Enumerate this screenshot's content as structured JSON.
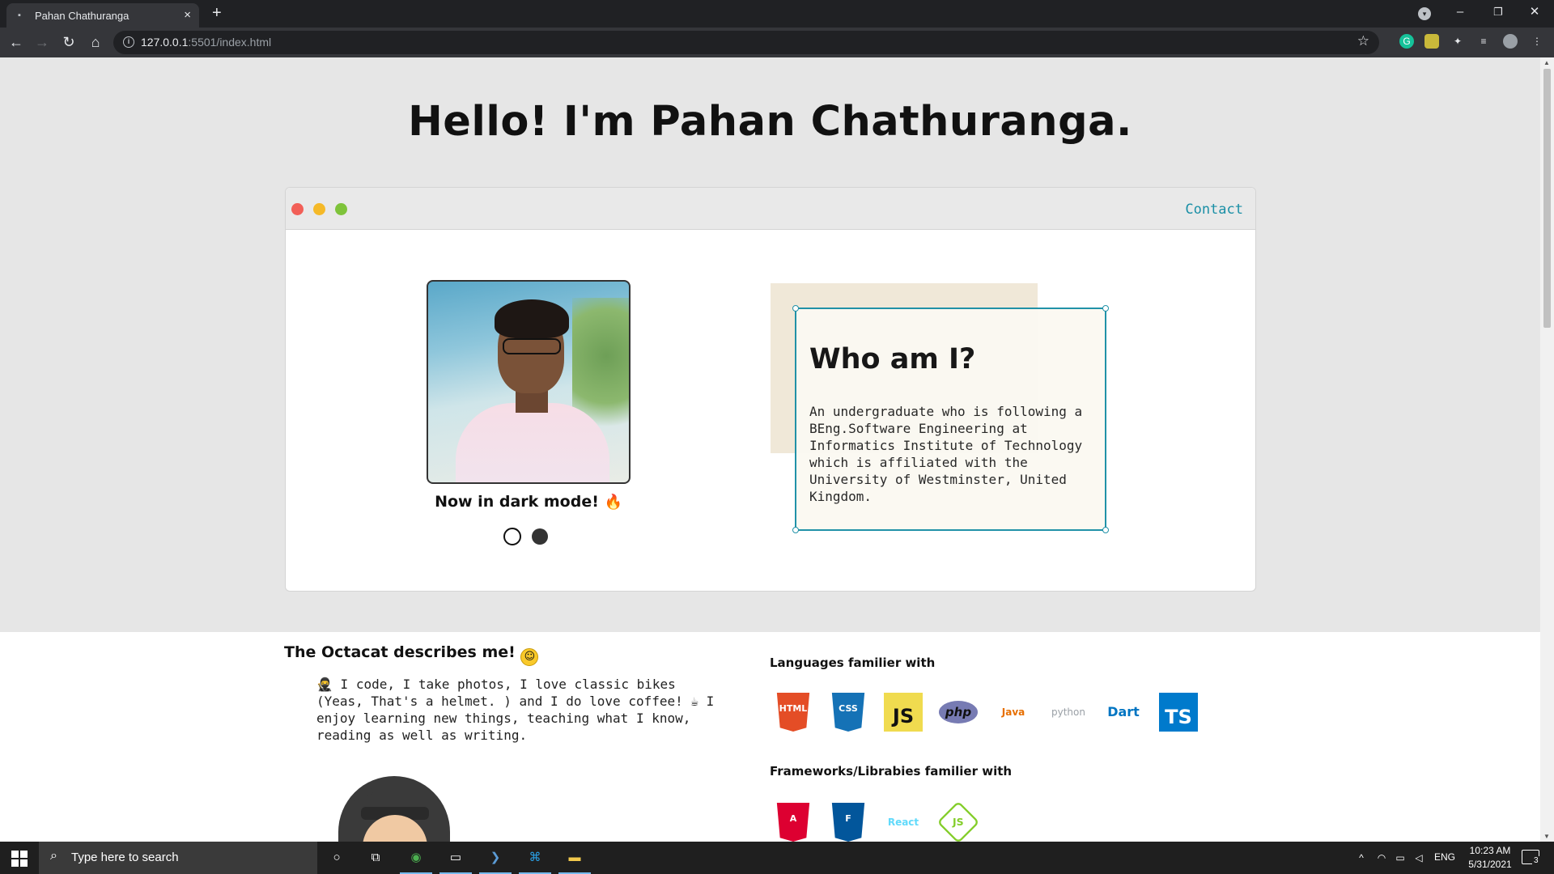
{
  "browser": {
    "tab_title": "Pahan Chathuranga",
    "tab_close": "×",
    "new_tab": "+",
    "url_host": "127.0.0.1",
    "url_rest": ":5501/index.html",
    "window_controls": [
      "–",
      "❐",
      "✕"
    ]
  },
  "page": {
    "hero_title": "Hello! I'm Pahan Chathuranga.",
    "window_bar": {
      "dot_colors": [
        "#f25f57",
        "#f5b928",
        "#7ec33a"
      ],
      "contact_label": "Contact"
    },
    "profile": {
      "dark_mode_caption": "Now in dark mode!",
      "flame_icon": "🔥",
      "toggles": [
        "light",
        "dark"
      ]
    },
    "about": {
      "title": "Who am I?",
      "text": "An undergraduate who is following a BEng.Software Engineering at Informatics Institute of Technology which is affiliated with the University of Westminster, United Kingdom."
    },
    "octacat": {
      "title": "The Octacat describes me!",
      "text": "🥷 I code, I take photos, I love classic bikes (Yeas, That's a helmet. ) and I do love coffee! ☕ I enjoy learning new things, teaching what I know, reading as well as writing."
    },
    "languages": {
      "title": "Languages familier with",
      "items": [
        {
          "name": "HTML5",
          "label": "HTML",
          "color": "#e44d26"
        },
        {
          "name": "CSS3",
          "label": "CSS",
          "color": "#1572b6"
        },
        {
          "name": "JavaScript",
          "label": "JS",
          "color": "#f0db4f"
        },
        {
          "name": "PHP",
          "label": "php",
          "color": "#777bb3"
        },
        {
          "name": "Java",
          "label": "Java",
          "color": "#e76f00"
        },
        {
          "name": "Python",
          "label": "python",
          "color": "#9aa0a6"
        },
        {
          "name": "Dart",
          "label": "Dart",
          "color": "#0175c2"
        },
        {
          "name": "TypeScript",
          "label": "TS",
          "color": "#007acc"
        }
      ]
    },
    "frameworks": {
      "title": "Frameworks/Librabies familier with",
      "items": [
        {
          "name": "Angular",
          "label": "A",
          "color": "#dd0031"
        },
        {
          "name": "Flutter",
          "label": "F",
          "color": "#02569b"
        },
        {
          "name": "React",
          "label": "React",
          "color": "#61dafb"
        },
        {
          "name": "Node.js",
          "label": "JS",
          "color": "#83cd29"
        }
      ]
    }
  },
  "taskbar": {
    "search_placeholder": "Type here to search",
    "language": "ENG",
    "time": "10:23 AM",
    "date": "5/31/2021",
    "notification_count": "3"
  }
}
